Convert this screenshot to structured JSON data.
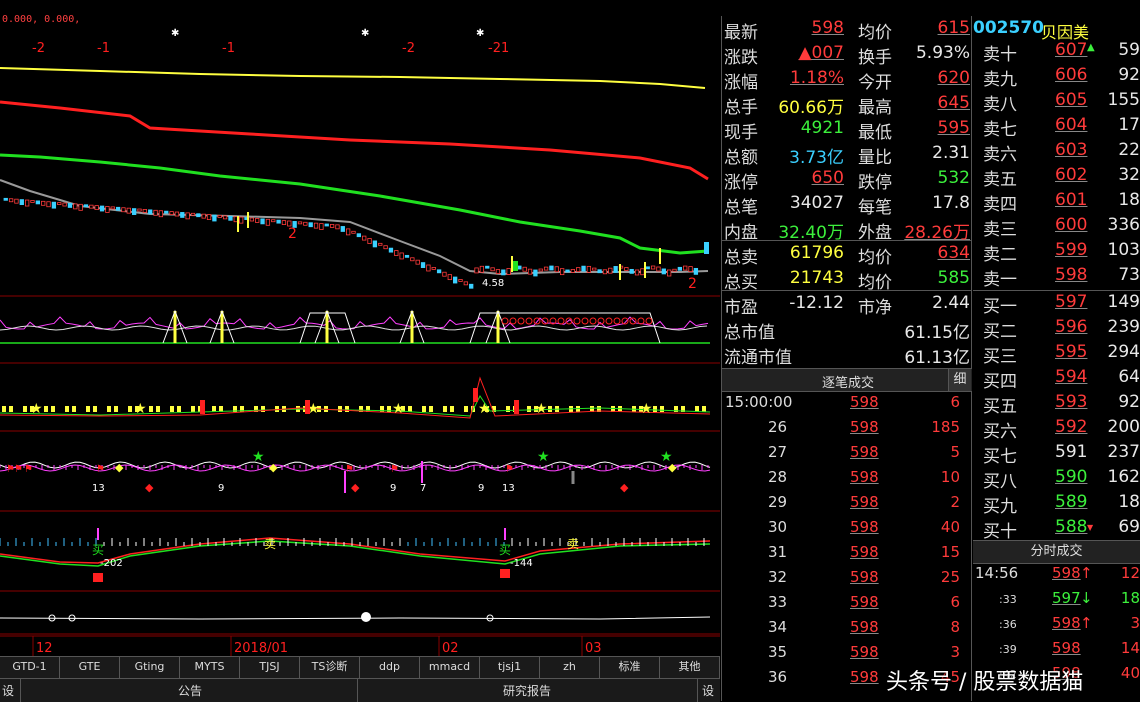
{
  "chart": {
    "header_values": "0.000, 0.000,",
    "top_marks": [
      "-2",
      "-1",
      "-1",
      "-2",
      "-21"
    ],
    "annotation_low": "4.58",
    "ma_label": "2",
    "ma_label2": "2",
    "ind_labels": [
      "-202",
      "-144"
    ],
    "sell_labels": [
      "卖",
      "卖"
    ],
    "buy_labels": [
      "买",
      "买"
    ],
    "osc_numbers": [
      "13",
      "9",
      "9",
      "7",
      "13",
      "9"
    ],
    "date_labels": [
      "12",
      "2018/01",
      "02",
      "03"
    ],
    "colors": {
      "up": "#ff3b3b",
      "down": "#3bd0ff",
      "ma1": "#ffff40",
      "ma2": "#ff2020",
      "ma3": "#20e020",
      "ma4": "#999999"
    }
  },
  "tabs": [
    "GTD-1",
    "GTE",
    "Gting",
    "MYTS",
    "TJSJ",
    "TS诊断",
    "ddp",
    "mmacd",
    "tjsj1",
    "zh",
    "标准",
    "其他"
  ],
  "bottom": {
    "left_btn": "设",
    "notice": "公告",
    "research": "研究报告",
    "right_btn": "设"
  },
  "quote": {
    "rows": [
      {
        "l1": "最新",
        "v1": "598",
        "c1": "red",
        "l2": "均价",
        "v2": "615",
        "c2": "red"
      },
      {
        "l1": "涨跌",
        "v1": "▲007",
        "c1": "red",
        "l2": "换手",
        "v2": "5.93%",
        "c2": "white"
      },
      {
        "l1": "涨幅",
        "v1": "1.18%",
        "c1": "red",
        "l2": "今开",
        "v2": "620",
        "c2": "red"
      },
      {
        "l1": "总手",
        "v1": "60.66万",
        "c1": "yellow",
        "l2": "最高",
        "v2": "645",
        "c2": "red"
      },
      {
        "l1": "现手",
        "v1": "4921",
        "c1": "green",
        "l2": "最低",
        "v2": "595",
        "c2": "red"
      },
      {
        "l1": "总额",
        "v1": "3.73亿",
        "c1": "cyan",
        "l2": "量比",
        "v2": "2.31",
        "c2": "white"
      },
      {
        "l1": "涨停",
        "v1": "650",
        "c1": "red",
        "l2": "跌停",
        "v2": "532",
        "c2": "green"
      },
      {
        "l1": "总笔",
        "v1": "34027",
        "c1": "white",
        "l2": "每笔",
        "v2": "17.8",
        "c2": "white"
      },
      {
        "l1": "内盘",
        "v1": "32.40万",
        "c1": "green",
        "l2": "外盘",
        "v2": "28.26万",
        "c2": "red"
      },
      {
        "l1": "总卖",
        "v1": "61796",
        "c1": "yellow",
        "l2": "均价",
        "v2": "634",
        "c2": "red"
      },
      {
        "l1": "总买",
        "v1": "21743",
        "c1": "yellow",
        "l2": "均价",
        "v2": "585",
        "c2": "green"
      },
      {
        "l1": "市盈",
        "v1": "-12.12",
        "c1": "white",
        "l2": "市净",
        "v2": "2.44",
        "c2": "white"
      },
      {
        "l1": "总市值",
        "v1": "",
        "c1": "white",
        "l2": "",
        "v2": "61.15亿",
        "c2": "white"
      },
      {
        "l1": "流通市值",
        "v1": "",
        "c1": "white",
        "l2": "",
        "v2": "61.13亿",
        "c2": "white"
      }
    ]
  },
  "trades_header": "逐笔成交",
  "trades_header_btn": "细",
  "trades": [
    {
      "t": "15:00:00",
      "p": "598",
      "v": "6"
    },
    {
      "t": "26",
      "p": "598",
      "v": "185"
    },
    {
      "t": "27",
      "p": "598",
      "v": "5"
    },
    {
      "t": "28",
      "p": "598",
      "v": "10"
    },
    {
      "t": "29",
      "p": "598",
      "v": "2"
    },
    {
      "t": "30",
      "p": "598",
      "v": "40"
    },
    {
      "t": "31",
      "p": "598",
      "v": "15"
    },
    {
      "t": "32",
      "p": "598",
      "v": "25"
    },
    {
      "t": "33",
      "p": "598",
      "v": "6"
    },
    {
      "t": "34",
      "p": "598",
      "v": "8"
    },
    {
      "t": "35",
      "p": "598",
      "v": "3"
    },
    {
      "t": "36",
      "p": "598",
      "v": "45"
    }
  ],
  "stock": {
    "code": "002570",
    "name": "贝因美"
  },
  "orderbook": [
    {
      "l": "卖十",
      "p": "607",
      "c": "red",
      "v": "59"
    },
    {
      "l": "卖九",
      "p": "606",
      "c": "red",
      "v": "92"
    },
    {
      "l": "卖八",
      "p": "605",
      "c": "red",
      "v": "155"
    },
    {
      "l": "卖七",
      "p": "604",
      "c": "red",
      "v": "17"
    },
    {
      "l": "卖六",
      "p": "603",
      "c": "red",
      "v": "22"
    },
    {
      "l": "卖五",
      "p": "602",
      "c": "red",
      "v": "32"
    },
    {
      "l": "卖四",
      "p": "601",
      "c": "red",
      "v": "18"
    },
    {
      "l": "卖三",
      "p": "600",
      "c": "red",
      "v": "336"
    },
    {
      "l": "卖二",
      "p": "599",
      "c": "red",
      "v": "103"
    },
    {
      "l": "卖一",
      "p": "598",
      "c": "red",
      "v": "73"
    },
    {
      "l": "买一",
      "p": "597",
      "c": "red",
      "v": "149"
    },
    {
      "l": "买二",
      "p": "596",
      "c": "red",
      "v": "239"
    },
    {
      "l": "买三",
      "p": "595",
      "c": "red",
      "v": "294"
    },
    {
      "l": "买四",
      "p": "594",
      "c": "red",
      "v": "64"
    },
    {
      "l": "买五",
      "p": "593",
      "c": "red",
      "v": "92"
    },
    {
      "l": "买六",
      "p": "592",
      "c": "red",
      "v": "200"
    },
    {
      "l": "买七",
      "p": "591",
      "c": "white",
      "v": "237"
    },
    {
      "l": "买八",
      "p": "590",
      "c": "green",
      "v": "162"
    },
    {
      "l": "买九",
      "p": "589",
      "c": "green",
      "v": "18"
    },
    {
      "l": "买十",
      "p": "588",
      "c": "green",
      "v": "69"
    }
  ],
  "tick_header": "分时成交",
  "ticks": [
    {
      "t": "14:56",
      "small": false,
      "p": "598",
      "arrow": "↑",
      "c": "red",
      "v": "12"
    },
    {
      "t": ":33",
      "small": true,
      "p": "597",
      "arrow": "↓",
      "c": "green",
      "v": "18"
    },
    {
      "t": ":36",
      "small": true,
      "p": "598",
      "arrow": "↑",
      "c": "red",
      "v": "3"
    },
    {
      "t": ":39",
      "small": true,
      "p": "598",
      "arrow": "",
      "c": "red",
      "v": "14"
    },
    {
      "t": ":42",
      "small": true,
      "p": "598",
      "arrow": "",
      "c": "red",
      "v": "40"
    }
  ],
  "watermark": "头条号 / 股票数据猫"
}
